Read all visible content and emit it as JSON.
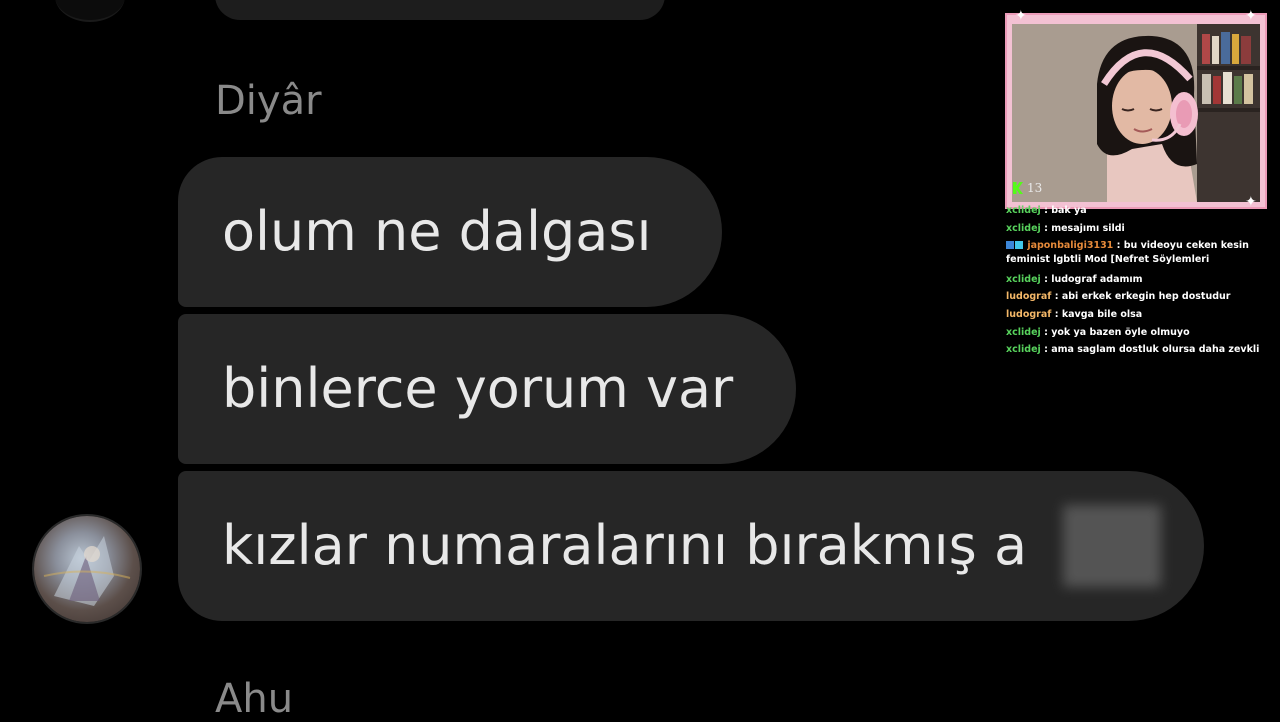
{
  "conversation": {
    "senders": [
      "Diyâr",
      "Ahu"
    ],
    "messages": [
      "olum ne dalgası",
      "binlerce yorum var",
      "kızlar numaralarını bırakmış a"
    ]
  },
  "stream": {
    "viewer_count": "13"
  },
  "chat": [
    {
      "user": "xclidej",
      "text": "bak ya"
    },
    {
      "user": "xclidej",
      "text": "mesajımı sildi"
    },
    {
      "user": "japonbaligi3131",
      "text": "bu videoyu ceken kesin feminist lgbtli Mod [Nefret Söylemleri"
    },
    {
      "user": "xclidej",
      "text": "ludograf adamım"
    },
    {
      "user": "ludograf",
      "text": "abi erkek erkegin hep dostudur"
    },
    {
      "user": "ludograf",
      "text": "kavga bile olsa"
    },
    {
      "user": "xclidej",
      "text": "yok ya bazen öyle olmuyo"
    },
    {
      "user": "xclidej",
      "text": "ama saglam dostluk olursa daha zevkli"
    }
  ],
  "colors": {
    "bubble": "#262626",
    "sender_name": "#8a8a8a",
    "cam_border": "#f3c1d3",
    "kick_green": "#53fc18"
  }
}
